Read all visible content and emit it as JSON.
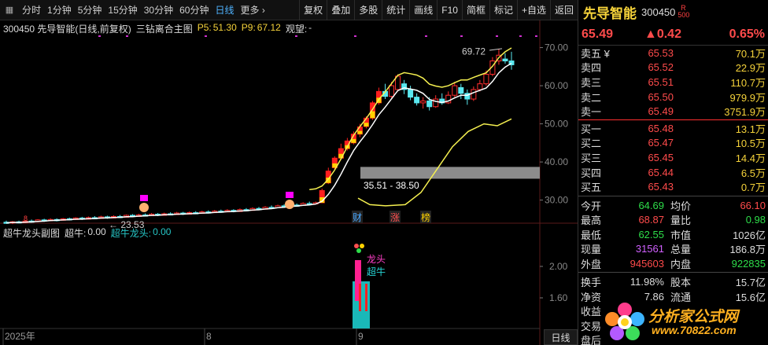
{
  "toolbar": {
    "periods": [
      "分时",
      "1分钟",
      "5分钟",
      "15分钟",
      "30分钟",
      "60分钟",
      "日线",
      "更多 ›"
    ],
    "active_period": "日线",
    "buttons": [
      "复权",
      "叠加",
      "多股",
      "统计",
      "画线",
      "F10",
      "简框",
      "标记",
      "+自选",
      "返回"
    ]
  },
  "chart_header": {
    "code_name": "300450 先导智能(日线,前复权)",
    "indicator": "三钻离合主图",
    "p5_label": "P5:",
    "p5": "51.30",
    "p9_label": "P9:",
    "p9": "67.12",
    "watch": "观望:",
    "watch_val": "-"
  },
  "sub_header": {
    "name": "超牛龙头副图",
    "cn_label": "超牛:",
    "cn_val": "0.00",
    "lt_label": "超牛龙头:",
    "lt_val": "0.00"
  },
  "chart_data": {
    "type": "candlestick",
    "y_axis_ticks": [
      "70.00",
      "60.00",
      "50.00",
      "40.00",
      "30.00"
    ],
    "y_range": [
      26,
      73
    ],
    "sub_axis_ticks": [
      "2.00",
      "1.60"
    ],
    "x_labels": [
      "2025年",
      "8",
      "9"
    ],
    "annotations": {
      "high": "69.72",
      "low": "23.53",
      "range_box": "35.51 - 38.50",
      "sub_labels": [
        "龙头",
        "超牛"
      ],
      "event_marks": [
        "财",
        "涨",
        "榜"
      ]
    },
    "candles": [
      [
        24.2,
        24.0,
        24.6,
        23.8
      ],
      [
        24.0,
        24.3,
        24.5,
        23.7
      ],
      [
        24.3,
        24.1,
        24.6,
        23.9
      ],
      [
        24.1,
        24.5,
        24.8,
        24.0
      ],
      [
        24.5,
        24.4,
        24.9,
        24.1
      ],
      [
        24.4,
        24.8,
        25.0,
        24.2
      ],
      [
        24.8,
        24.6,
        25.1,
        24.3
      ],
      [
        24.6,
        24.9,
        25.2,
        24.5
      ],
      [
        24.9,
        24.7,
        25.2,
        24.4
      ],
      [
        24.7,
        25.1,
        25.3,
        24.6
      ],
      [
        25.1,
        24.9,
        25.4,
        24.7
      ],
      [
        24.9,
        25.3,
        25.5,
        24.8
      ],
      [
        25.3,
        25.0,
        25.6,
        24.8
      ],
      [
        25.0,
        25.4,
        25.7,
        24.9
      ],
      [
        25.4,
        25.2,
        25.8,
        25.0
      ],
      [
        25.2,
        25.6,
        25.9,
        25.1
      ],
      [
        25.6,
        25.3,
        25.9,
        25.1
      ],
      [
        25.3,
        25.7,
        26.0,
        25.2
      ],
      [
        25.7,
        25.5,
        26.1,
        25.3
      ],
      [
        25.5,
        26.0,
        26.2,
        25.4
      ],
      [
        26.0,
        25.7,
        26.3,
        25.5
      ],
      [
        25.7,
        26.1,
        26.4,
        25.6
      ],
      [
        26.1,
        25.9,
        26.5,
        25.7
      ],
      [
        25.9,
        26.3,
        26.6,
        25.8
      ],
      [
        26.3,
        26.0,
        26.6,
        25.8
      ],
      [
        26.0,
        26.4,
        26.7,
        25.9
      ],
      [
        26.4,
        26.2,
        26.8,
        26.0
      ],
      [
        26.2,
        26.6,
        26.9,
        26.1
      ],
      [
        26.6,
        26.3,
        26.9,
        26.1
      ],
      [
        26.3,
        26.7,
        27.0,
        26.2
      ],
      [
        26.7,
        26.5,
        27.1,
        26.3
      ],
      [
        26.5,
        26.9,
        27.2,
        26.4
      ],
      [
        26.9,
        26.7,
        27.3,
        26.5
      ],
      [
        26.7,
        27.1,
        27.4,
        26.6
      ],
      [
        27.1,
        26.9,
        27.5,
        26.7
      ],
      [
        26.9,
        27.3,
        27.6,
        26.8
      ],
      [
        27.3,
        27.0,
        27.6,
        26.8
      ],
      [
        27.0,
        27.5,
        27.8,
        26.9
      ],
      [
        27.5,
        27.3,
        27.9,
        27.1
      ],
      [
        27.3,
        27.8,
        28.1,
        27.2
      ],
      [
        27.8,
        27.6,
        28.2,
        27.4
      ],
      [
        27.6,
        28.1,
        28.4,
        27.5
      ],
      [
        28.1,
        28.0,
        28.6,
        27.8
      ],
      [
        28.0,
        28.5,
        28.8,
        27.9
      ],
      [
        28.5,
        28.3,
        28.9,
        28.1
      ],
      [
        28.3,
        28.7,
        29.0,
        28.2
      ],
      [
        28.7,
        28.6,
        29.1,
        28.4
      ],
      [
        28.6,
        29.1,
        29.4,
        28.5
      ],
      [
        29.1,
        29.0,
        29.6,
        28.8
      ],
      [
        29.0,
        29.3,
        29.6,
        28.9
      ],
      [
        29.3,
        32.5,
        33.0,
        29.2
      ],
      [
        34.5,
        37.6,
        38.5,
        34.2
      ],
      [
        38.5,
        41.0,
        41.5,
        38.0
      ],
      [
        41.0,
        43.5,
        44.8,
        40.5
      ],
      [
        43.5,
        45.5,
        46.3,
        43.0
      ],
      [
        45.0,
        47.3,
        48.0,
        44.6
      ],
      [
        47.3,
        49.2,
        50.0,
        46.5
      ],
      [
        49.3,
        51.5,
        52.0,
        48.8
      ],
      [
        51.5,
        55.5,
        56.0,
        51.0
      ],
      [
        55.5,
        58.5,
        59.5,
        55.0
      ],
      [
        58.5,
        57.2,
        60.5,
        56.5
      ],
      [
        57.2,
        60.0,
        61.0,
        56.8
      ],
      [
        59.0,
        62.5,
        63.0,
        58.5
      ],
      [
        60.5,
        59.0,
        61.5,
        57.8
      ],
      [
        59.0,
        57.0,
        60.0,
        56.2
      ],
      [
        57.0,
        55.5,
        58.0,
        54.8
      ],
      [
        55.5,
        56.0,
        57.0,
        54.0
      ],
      [
        56.0,
        54.5,
        57.0,
        53.5
      ],
      [
        54.5,
        56.5,
        57.5,
        54.2
      ],
      [
        56.5,
        55.5,
        58.0,
        55.0
      ],
      [
        55.5,
        57.5,
        58.5,
        55.2
      ],
      [
        57.5,
        60.0,
        61.0,
        57.0
      ],
      [
        59.5,
        58.0,
        60.5,
        56.5
      ],
      [
        58.0,
        56.5,
        59.0,
        55.0
      ],
      [
        56.5,
        59.0,
        59.8,
        56.0
      ],
      [
        59.0,
        60.5,
        61.5,
        58.5
      ],
      [
        60.5,
        63.0,
        64.0,
        60.0
      ],
      [
        63.0,
        66.5,
        67.5,
        62.5
      ],
      [
        66.5,
        68.0,
        69.72,
        65.5
      ],
      [
        67.0,
        66.5,
        68.5,
        65.8
      ],
      [
        66.5,
        65.49,
        68.9,
        64.2
      ]
    ],
    "start_index": 0,
    "end_index": 80
  },
  "quote": {
    "name": "先导智能",
    "code": "300450",
    "badge": "R 500",
    "price": "65.49",
    "change": "▲0.42",
    "pct": "0.65%",
    "asks": [
      {
        "label": "卖五 ¥",
        "price": "65.53",
        "vol": "70.1万"
      },
      {
        "label": "卖四",
        "price": "65.52",
        "vol": "22.9万"
      },
      {
        "label": "卖三",
        "price": "65.51",
        "vol": "110.7万"
      },
      {
        "label": "卖二",
        "price": "65.50",
        "vol": "979.9万"
      },
      {
        "label": "卖一",
        "price": "65.49",
        "vol": "3751.9万"
      }
    ],
    "bids": [
      {
        "label": "买一",
        "price": "65.48",
        "vol": "13.1万"
      },
      {
        "label": "买二",
        "price": "65.47",
        "vol": "10.5万"
      },
      {
        "label": "买三",
        "price": "65.45",
        "vol": "14.4万"
      },
      {
        "label": "买四",
        "price": "65.44",
        "vol": "6.5万"
      },
      {
        "label": "买五",
        "price": "65.43",
        "vol": "0.7万"
      }
    ],
    "stats": [
      {
        "l1": "今开",
        "v1": "64.69",
        "c1": "green",
        "l2": "均价",
        "v2": "66.10",
        "c2": "red"
      },
      {
        "l1": "最高",
        "v1": "68.87",
        "c1": "red",
        "l2": "量比",
        "v2": "0.98",
        "c2": "green"
      },
      {
        "l1": "最低",
        "v1": "62.55",
        "c1": "green",
        "l2": "市值",
        "v2": "1026亿",
        "c2": "white"
      },
      {
        "l1": "现量",
        "v1": "31561",
        "c1": "purple",
        "l2": "总量",
        "v2": "186.8万",
        "c2": "white"
      },
      {
        "l1": "外盘",
        "v1": "945603",
        "c1": "red",
        "l2": "内盘",
        "v2": "922835",
        "c2": "green"
      }
    ],
    "stats2": [
      {
        "l1": "换手",
        "v1": "11.98%",
        "l2": "股本",
        "v2": "15.7亿"
      },
      {
        "l1": "净资",
        "v1": "7.86",
        "l2": "流通",
        "v2": "15.6亿"
      },
      {
        "l1": "收益",
        "v1": "",
        "l2": "",
        "v2": ""
      },
      {
        "l1": "交易",
        "v1": "",
        "l2": "",
        "v2": ""
      },
      {
        "l1": "盘后",
        "v1": "",
        "l2": "",
        "v2": ""
      }
    ]
  },
  "watermark": {
    "text": "分析家公式网",
    "url": "www.70822.com"
  },
  "bottom_tab": "日线"
}
